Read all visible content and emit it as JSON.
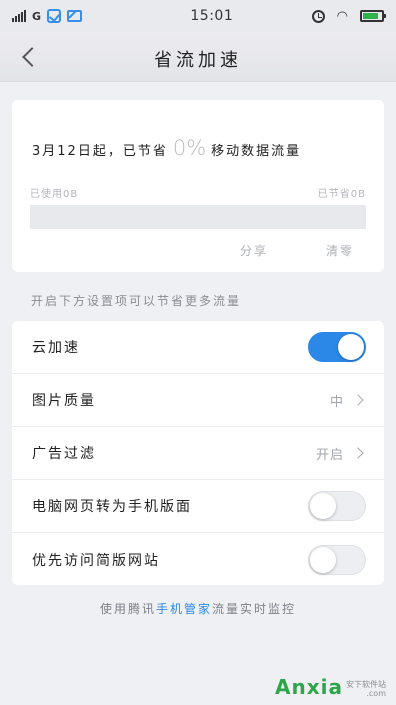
{
  "status_bar": {
    "network": "G",
    "time": "15:01",
    "wifi_glyph": "◠",
    "battery_level": 0.85
  },
  "header": {
    "title": "省流加速",
    "back_icon": "chevron-left-icon"
  },
  "summary": {
    "prefix": "3月12日起，已节省",
    "percent": "0%",
    "suffix": "移动数据流量",
    "used_label": "已使用0B",
    "saved_label": "已节省0B",
    "usage_fraction": 0,
    "share_label": "分享",
    "clear_label": "清零"
  },
  "section_hint": "开启下方设置项可以节省更多流量",
  "settings": [
    {
      "label": "云加速",
      "type": "toggle",
      "on": true
    },
    {
      "label": "图片质量",
      "type": "value",
      "value": "中"
    },
    {
      "label": "广告过滤",
      "type": "value",
      "value": "开启"
    },
    {
      "label": "电脑网页转为手机版面",
      "type": "toggle",
      "on": false
    },
    {
      "label": "优先访问简版网站",
      "type": "toggle",
      "on": false
    }
  ],
  "footer": {
    "before": "使用腾讯",
    "link": "手机管家",
    "after": "流量实时监控"
  },
  "watermark": {
    "logo": "Anxia",
    "domain": ".com",
    "sub": "安下软件站"
  },
  "colors": {
    "accent": "#2b88e6",
    "battery": "#2fb24a",
    "watermark": "#2fa54b"
  }
}
